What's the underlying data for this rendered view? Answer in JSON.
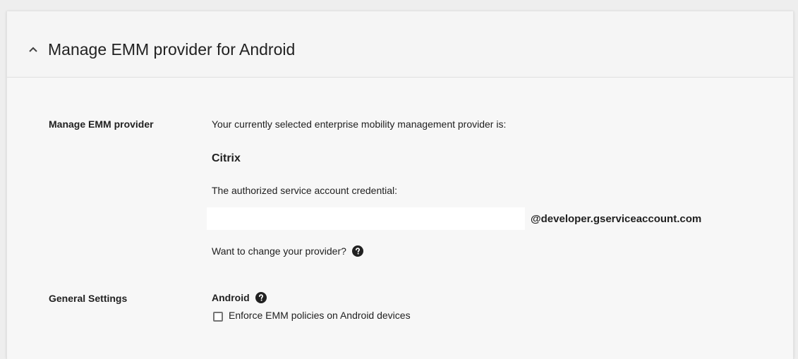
{
  "section": {
    "title": "Manage EMM provider for Android",
    "collapse_icon": "chevron-up-icon"
  },
  "emm_provider": {
    "label": "Manage EMM provider",
    "description": "Your currently selected enterprise mobility management provider is:",
    "provider_name": "Citrix",
    "credential_label": "The authorized service account credential:",
    "credential_domain": "@developer.gserviceaccount.com",
    "change_prompt": "Want to change your provider?",
    "help_icon": "help-circle-icon"
  },
  "general_settings": {
    "label": "General Settings",
    "platform": "Android",
    "help_icon": "help-circle-icon",
    "enforce_checkbox": {
      "label": "Enforce EMM policies on Android devices",
      "checked": false
    }
  }
}
